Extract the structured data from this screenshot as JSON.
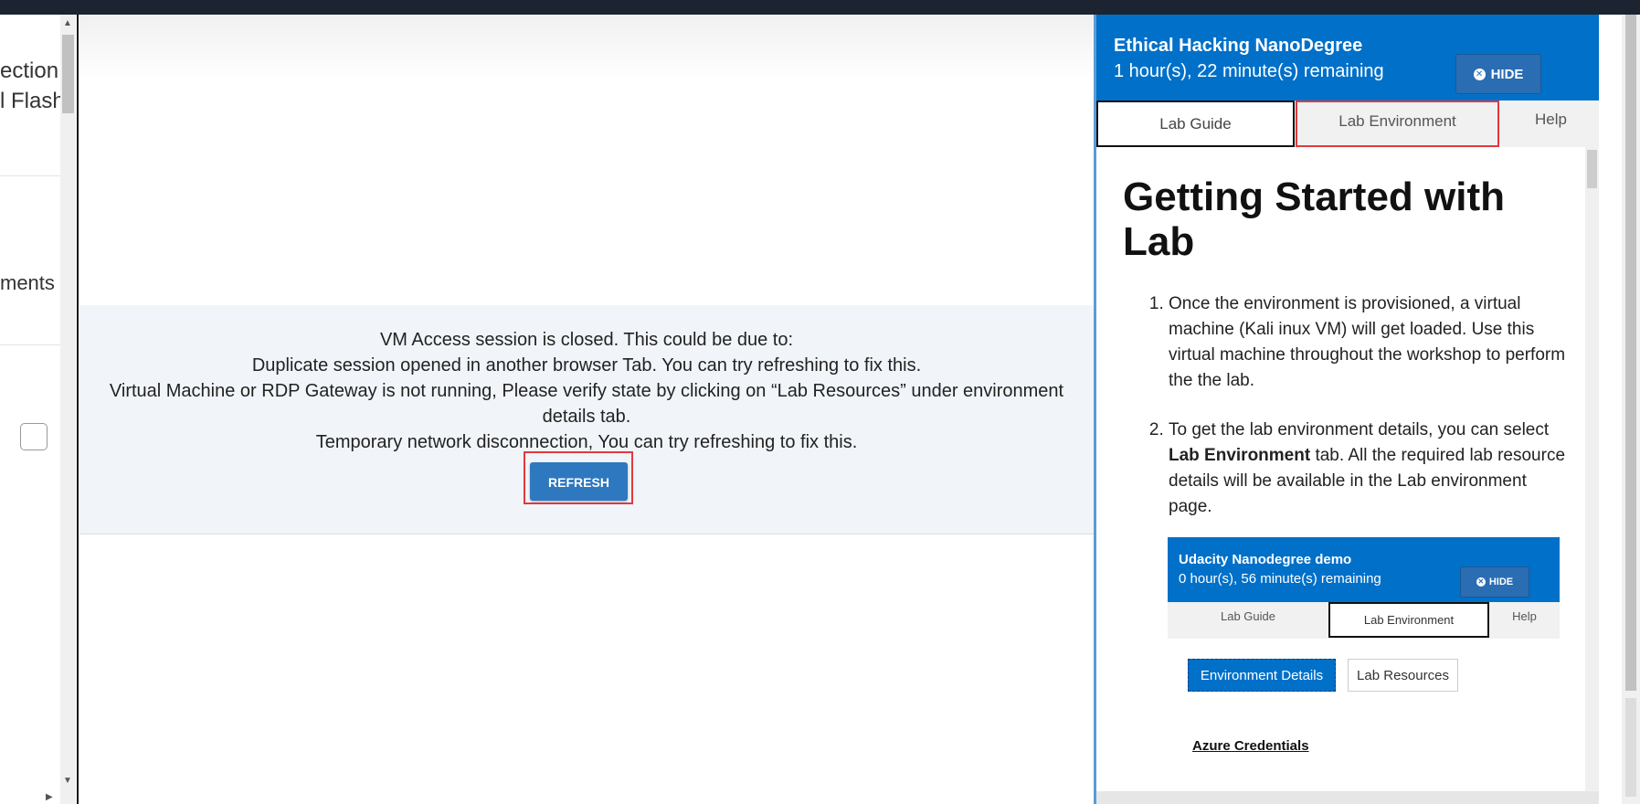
{
  "left_panel": {
    "texts": [
      "ection",
      "l Flash",
      "ments"
    ]
  },
  "vm": {
    "notice_lines": [
      "VM Access session is closed. This could be due to:",
      "Duplicate session opened in another browser Tab. You can try refreshing to fix this.",
      "Virtual Machine or RDP Gateway is not running, Please verify state by clicking on “Lab Resources” under environment details tab.",
      "Temporary network disconnection, You can try refreshing to fix this."
    ],
    "refresh_label": "REFRESH"
  },
  "lab_panel": {
    "title": "Ethical Hacking NanoDegree",
    "remaining": "1 hour(s), 22 minute(s) remaining",
    "hide_label": "HIDE",
    "tabs": [
      {
        "label": "Lab Guide",
        "active": true
      },
      {
        "label": "Lab Environment",
        "highlighted": true
      },
      {
        "label": "Help"
      }
    ],
    "guide": {
      "heading": "Getting Started with Lab",
      "steps": [
        {
          "text": "Once the environment is provisioned, a virtual machine (Kali inux VM) will get loaded. Use this virtual machine throughout the workshop to perform the the lab."
        },
        {
          "before": "To get the lab environment details, you can select ",
          "bold": "Lab Environment",
          "after": " tab. All the required lab resource details will be available in the Lab environment page."
        }
      ],
      "screenshot": {
        "title": "Udacity Nanodegree demo",
        "remaining": "0 hour(s), 56 minute(s) remaining",
        "hide_label": "HIDE",
        "tabs": [
          "Lab Guide",
          "Lab Environment",
          "Help"
        ],
        "env_details_label": "Environment Details",
        "lab_resources_label": "Lab Resources",
        "azure_credentials": "Azure Credentials"
      }
    }
  },
  "colors": {
    "header_blue": "#0070c9",
    "refresh_blue": "#2e78c0",
    "highlight_red": "#e0393e",
    "topbar": "#1b2430"
  }
}
